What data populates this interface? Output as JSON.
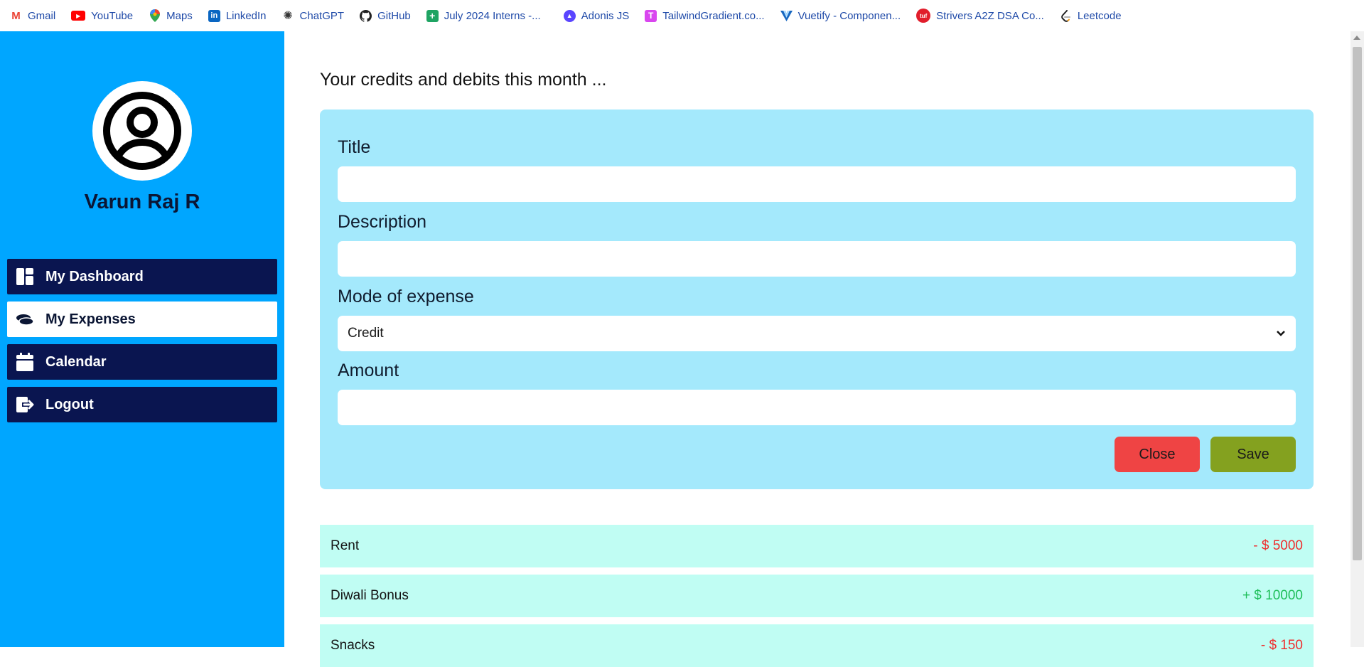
{
  "bookmarks": [
    {
      "label": "Gmail",
      "icon": "gmail-icon",
      "color": "#ea4335",
      "glyph": "M"
    },
    {
      "label": "YouTube",
      "icon": "youtube-icon",
      "color": "#ff0000",
      "glyph": "▶"
    },
    {
      "label": "Maps",
      "icon": "maps-icon",
      "color": "#34a853",
      "glyph": "●"
    },
    {
      "label": "LinkedIn",
      "icon": "linkedin-icon",
      "color": "#0a66c2",
      "glyph": "in"
    },
    {
      "label": "ChatGPT",
      "icon": "chatgpt-icon",
      "color": "#555555",
      "glyph": "✦"
    },
    {
      "label": "GitHub",
      "icon": "github-icon",
      "color": "#222222",
      "glyph": "●"
    },
    {
      "label": "July 2024 Interns -...",
      "icon": "sheets-icon",
      "color": "#1fa463",
      "glyph": "+"
    },
    {
      "label": "Adonis JS",
      "icon": "adonis-icon",
      "color": "#5a45ff",
      "glyph": "▲"
    },
    {
      "label": "TailwindGradient.co...",
      "icon": "tailwindgradient-icon",
      "color": "#d946ef",
      "glyph": "T"
    },
    {
      "label": "Vuetify - Componen...",
      "icon": "vuetify-icon",
      "color": "#1867c0",
      "glyph": "V"
    },
    {
      "label": "Strivers A2Z DSA Co...",
      "icon": "tuf-icon",
      "color": "#e11d2b",
      "glyph": "tuf"
    },
    {
      "label": "Leetcode",
      "icon": "leetcode-icon",
      "color": "#f89f1b",
      "glyph": "‹"
    }
  ],
  "sidebar": {
    "username": "Varun Raj R",
    "nav": [
      {
        "label": "My Dashboard",
        "icon": "dashboard-icon",
        "active": false
      },
      {
        "label": "My Expenses",
        "icon": "coins-icon",
        "active": true
      },
      {
        "label": "Calendar",
        "icon": "calendar-icon",
        "active": false
      },
      {
        "label": "Logout",
        "icon": "logout-icon",
        "active": false
      }
    ]
  },
  "main": {
    "heading": "Your credits and debits this month ...",
    "form": {
      "title_label": "Title",
      "title_value": "",
      "description_label": "Description",
      "description_value": "",
      "mode_label": "Mode of expense",
      "mode_value": "Credit",
      "amount_label": "Amount",
      "amount_value": "",
      "close_label": "Close",
      "save_label": "Save"
    },
    "transactions": [
      {
        "title": "Rent",
        "amount": "- $ 5000",
        "type": "debit"
      },
      {
        "title": "Diwali Bonus",
        "amount": "+ $ 10000",
        "type": "credit"
      },
      {
        "title": "Snacks",
        "amount": "- $ 150",
        "type": "debit"
      }
    ]
  },
  "colors": {
    "sidebar_bg": "#00a6ff",
    "nav_bg": "#0a1550",
    "form_bg": "#a4e9fc",
    "transaction_bg": "#c0fdf3",
    "close_button": "#ef4444",
    "save_button": "#84a11f",
    "debit": "#ef2d2d",
    "credit": "#1fbf5a"
  }
}
